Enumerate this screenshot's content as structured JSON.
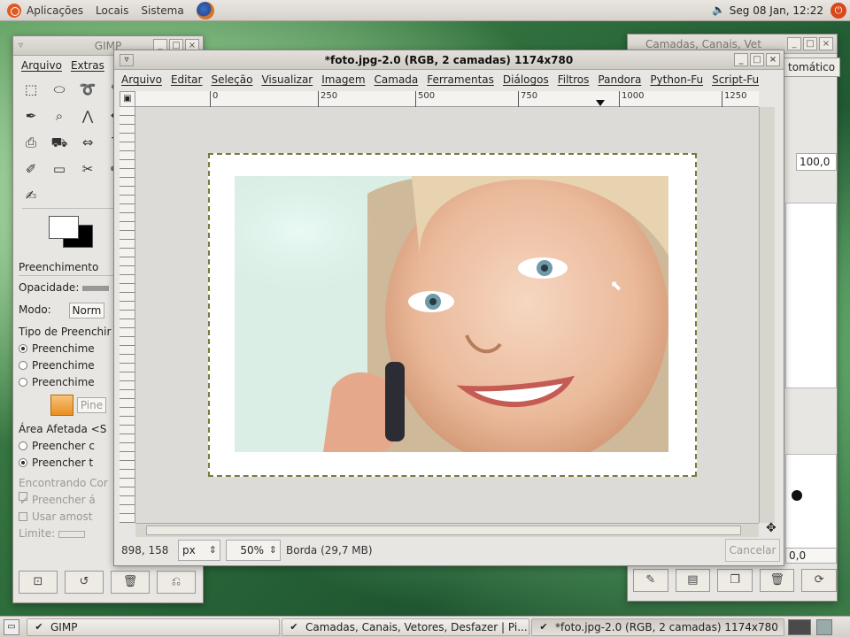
{
  "top_panel": {
    "menus": [
      "Aplicações",
      "Locais",
      "Sistema"
    ],
    "clock": "Seg 08 Jan, 12:22"
  },
  "toolbox": {
    "title": "GIMP",
    "menus": [
      "Arquivo",
      "Extras"
    ],
    "tool_options_title": "Preenchimento",
    "opacity_label": "Opacidade:",
    "mode_label": "Modo:",
    "mode_value": "Norm",
    "fill_type_label": "Tipo de Preenchir",
    "fill_types": [
      "Preenchime",
      "Preenchime",
      "Preenchime"
    ],
    "pattern_name": "Pine",
    "affected_area_label": "Área Afetada <S",
    "affected_options": [
      "Preencher c",
      "Preencher t"
    ],
    "finding_label": "Encontrando Cor",
    "fill_transparent": "Preencher á",
    "use_sample": "Usar amost",
    "limit_label": "Limite:"
  },
  "image_window": {
    "title": "*foto.jpg-2.0 (RGB, 2 camadas) 1174x780",
    "menus": [
      "Arquivo",
      "Editar",
      "Seleção",
      "Visualizar",
      "Imagem",
      "Camada",
      "Ferramentas",
      "Diálogos",
      "Filtros",
      "Pandora",
      "Python-Fu",
      "Script-Fu"
    ],
    "ruler_ticks": [
      "0",
      "250",
      "500",
      "750",
      "1000",
      "1250"
    ],
    "coords": "898, 158",
    "unit": "px",
    "zoom": "50%",
    "status_message": "Borda (29,7 MB)",
    "cancel_label": "Cancelar"
  },
  "layers_window": {
    "title": "Camadas, Canais, Vet",
    "mode_button": "tomático",
    "opacity_value": "100,0",
    "brush_spacing": "0,0"
  },
  "taskbar": {
    "items": [
      {
        "label": "GIMP"
      },
      {
        "label": "Camadas, Canais, Vetores, Desfazer | Pi..."
      },
      {
        "label": "*foto.jpg-2.0 (RGB, 2 camadas) 1174x780"
      }
    ]
  }
}
